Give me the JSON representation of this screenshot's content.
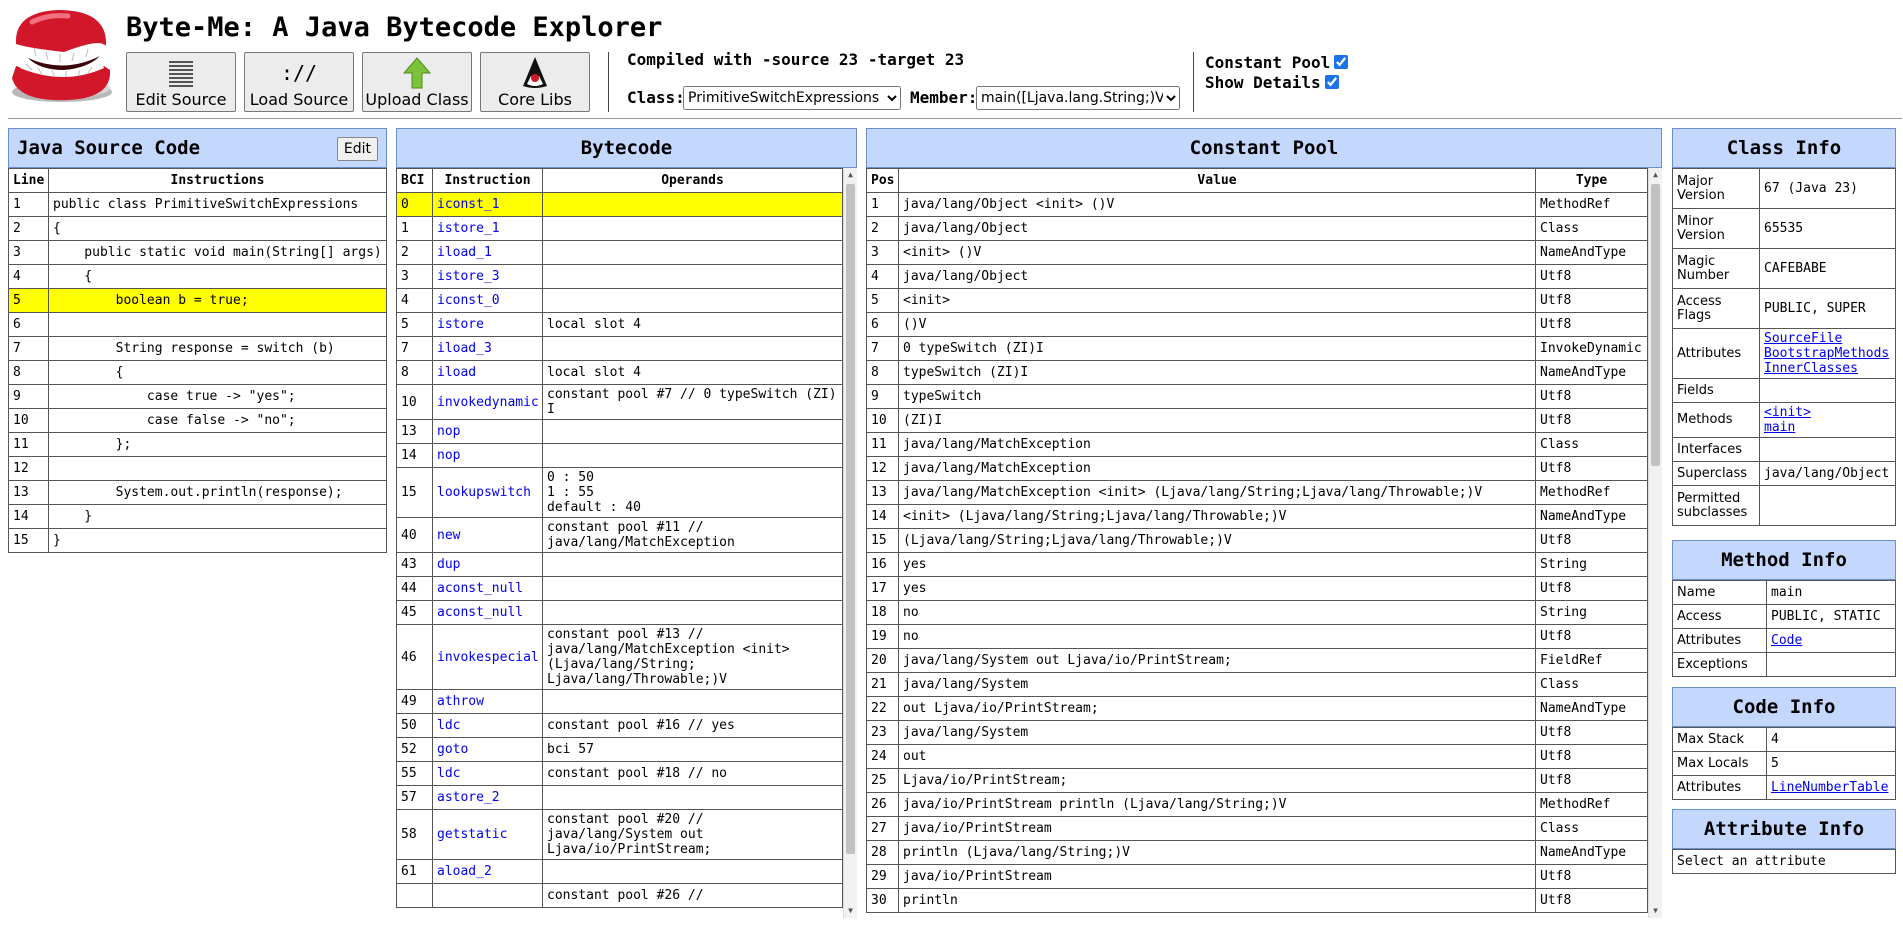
{
  "app": {
    "title": "Byte-Me: A Java Bytecode Explorer"
  },
  "toolbar": {
    "edit_source": "Edit Source",
    "load_source": "Load Source",
    "load_source_glyph": "://",
    "upload_class": "Upload Class",
    "core_libs": "Core Libs"
  },
  "compile": {
    "info": "Compiled with -source 23 -target 23",
    "class_label": "Class:",
    "class_value": "PrimitiveSwitchExpressions",
    "member_label": "Member:",
    "member_value": "main([Ljava.lang.String;)V"
  },
  "options": {
    "constant_pool_label": "Constant Pool",
    "constant_pool_checked": true,
    "show_details_label": "Show Details",
    "show_details_checked": true
  },
  "source": {
    "title": "Java Source Code",
    "edit_label": "Edit",
    "col_line": "Line",
    "col_instr": "Instructions",
    "highlight": 4,
    "lines": [
      [
        "1",
        "public class PrimitiveSwitchExpressions"
      ],
      [
        "2",
        "{"
      ],
      [
        "3",
        "    public static void main(String[] args)"
      ],
      [
        "4",
        "    {"
      ],
      [
        "5",
        "        boolean b = true;"
      ],
      [
        "6",
        ""
      ],
      [
        "7",
        "        String response = switch (b)"
      ],
      [
        "8",
        "        {"
      ],
      [
        "9",
        "            case true -> \"yes\";"
      ],
      [
        "10",
        "            case false -> \"no\";"
      ],
      [
        "11",
        "        };"
      ],
      [
        "12",
        ""
      ],
      [
        "13",
        "        System.out.println(response);"
      ],
      [
        "14",
        "    }"
      ],
      [
        "15",
        "}"
      ]
    ]
  },
  "bytecode": {
    "title": "Bytecode",
    "col_bci": "BCI",
    "col_instr": "Instruction",
    "col_operands": "Operands",
    "highlight": 0,
    "rows": [
      [
        "0",
        "iconst_1",
        ""
      ],
      [
        "1",
        "istore_1",
        ""
      ],
      [
        "2",
        "iload_1",
        ""
      ],
      [
        "3",
        "istore_3",
        ""
      ],
      [
        "4",
        "iconst_0",
        ""
      ],
      [
        "5",
        "istore",
        "local slot 4"
      ],
      [
        "7",
        "iload_3",
        ""
      ],
      [
        "8",
        "iload",
        "local slot 4"
      ],
      [
        "10",
        "invokedynamic",
        "constant pool #7 // 0 typeSwitch (ZI)\nI"
      ],
      [
        "13",
        "nop",
        ""
      ],
      [
        "14",
        "nop",
        ""
      ],
      [
        "15",
        "lookupswitch",
        "0 : 50\n1 : 55\ndefault : 40"
      ],
      [
        "40",
        "new",
        "constant pool #11 //\njava/lang/MatchException"
      ],
      [
        "43",
        "dup",
        ""
      ],
      [
        "44",
        "aconst_null",
        ""
      ],
      [
        "45",
        "aconst_null",
        ""
      ],
      [
        "46",
        "invokespecial",
        "constant pool #13 //\njava/lang/MatchException <init>\n(Ljava/lang/String;\nLjava/lang/Throwable;)V"
      ],
      [
        "49",
        "athrow",
        ""
      ],
      [
        "50",
        "ldc",
        "constant pool #16 // yes"
      ],
      [
        "52",
        "goto",
        "bci 57"
      ],
      [
        "55",
        "ldc",
        "constant pool #18 // no"
      ],
      [
        "57",
        "astore_2",
        ""
      ],
      [
        "58",
        "getstatic",
        "constant pool #20 //\njava/lang/System out\nLjava/io/PrintStream;"
      ],
      [
        "61",
        "aload_2",
        ""
      ],
      [
        "",
        "",
        "constant pool #26 //"
      ]
    ]
  },
  "constant_pool": {
    "title": "Constant Pool",
    "col_pos": "Pos",
    "col_value": "Value",
    "col_type": "Type",
    "rows": [
      [
        "1",
        "java/lang/Object <init> ()V",
        "MethodRef"
      ],
      [
        "2",
        "java/lang/Object",
        "Class"
      ],
      [
        "3",
        "<init> ()V",
        "NameAndType"
      ],
      [
        "4",
        "java/lang/Object",
        "Utf8"
      ],
      [
        "5",
        "<init>",
        "Utf8"
      ],
      [
        "6",
        "()V",
        "Utf8"
      ],
      [
        "7",
        "0 typeSwitch (ZI)I",
        "InvokeDynamic"
      ],
      [
        "8",
        "typeSwitch (ZI)I",
        "NameAndType"
      ],
      [
        "9",
        "typeSwitch",
        "Utf8"
      ],
      [
        "10",
        "(ZI)I",
        "Utf8"
      ],
      [
        "11",
        "java/lang/MatchException",
        "Class"
      ],
      [
        "12",
        "java/lang/MatchException",
        "Utf8"
      ],
      [
        "13",
        "java/lang/MatchException <init> (Ljava/lang/String;Ljava/lang/Throwable;)V",
        "MethodRef"
      ],
      [
        "14",
        "<init> (Ljava/lang/String;Ljava/lang/Throwable;)V",
        "NameAndType"
      ],
      [
        "15",
        "(Ljava/lang/String;Ljava/lang/Throwable;)V",
        "Utf8"
      ],
      [
        "16",
        "yes",
        "String"
      ],
      [
        "17",
        "yes",
        "Utf8"
      ],
      [
        "18",
        "no",
        "String"
      ],
      [
        "19",
        "no",
        "Utf8"
      ],
      [
        "20",
        "java/lang/System out Ljava/io/PrintStream;",
        "FieldRef"
      ],
      [
        "21",
        "java/lang/System",
        "Class"
      ],
      [
        "22",
        "out Ljava/io/PrintStream;",
        "NameAndType"
      ],
      [
        "23",
        "java/lang/System",
        "Utf8"
      ],
      [
        "24",
        "out",
        "Utf8"
      ],
      [
        "25",
        "Ljava/io/PrintStream;",
        "Utf8"
      ],
      [
        "26",
        "java/io/PrintStream println (Ljava/lang/String;)V",
        "MethodRef"
      ],
      [
        "27",
        "java/io/PrintStream",
        "Class"
      ],
      [
        "28",
        "println (Ljava/lang/String;)V",
        "NameAndType"
      ],
      [
        "29",
        "java/io/PrintStream",
        "Utf8"
      ],
      [
        "30",
        "println",
        "Utf8"
      ]
    ]
  },
  "class_info": {
    "title": "Class Info",
    "major_version_label": "Major Version",
    "major_version": "67 (Java 23)",
    "minor_version_label": "Minor Version",
    "minor_version": "65535",
    "magic_label": "Magic Number",
    "magic": "CAFEBABE",
    "access_label": "Access Flags",
    "access": "PUBLIC, SUPER",
    "attributes_label": "Attributes",
    "attributes": [
      "SourceFile",
      "BootstrapMethods",
      "InnerClasses"
    ],
    "fields_label": "Fields",
    "methods_label": "Methods",
    "methods": [
      "<init>",
      "main"
    ],
    "interfaces_label": "Interfaces",
    "superclass_label": "Superclass",
    "superclass": "java/lang/Object",
    "permitted_label": "Permitted subclasses"
  },
  "method_info": {
    "title": "Method Info",
    "name_label": "Name",
    "name": "main",
    "access_label": "Access",
    "access": "PUBLIC, STATIC",
    "attributes_label": "Attributes",
    "attribute": "Code",
    "exceptions_label": "Exceptions"
  },
  "code_info": {
    "title": "Code Info",
    "max_stack_label": "Max Stack",
    "max_stack": "4",
    "max_locals_label": "Max Locals",
    "max_locals": "5",
    "attributes_label": "Attributes",
    "attribute": "LineNumberTable"
  },
  "attribute_info": {
    "title": "Attribute Info",
    "placeholder": "Select an attribute"
  },
  "colors": {
    "header_bg": "#c4d7fd",
    "highlight": "#ffff00",
    "link": "#0000ee"
  }
}
